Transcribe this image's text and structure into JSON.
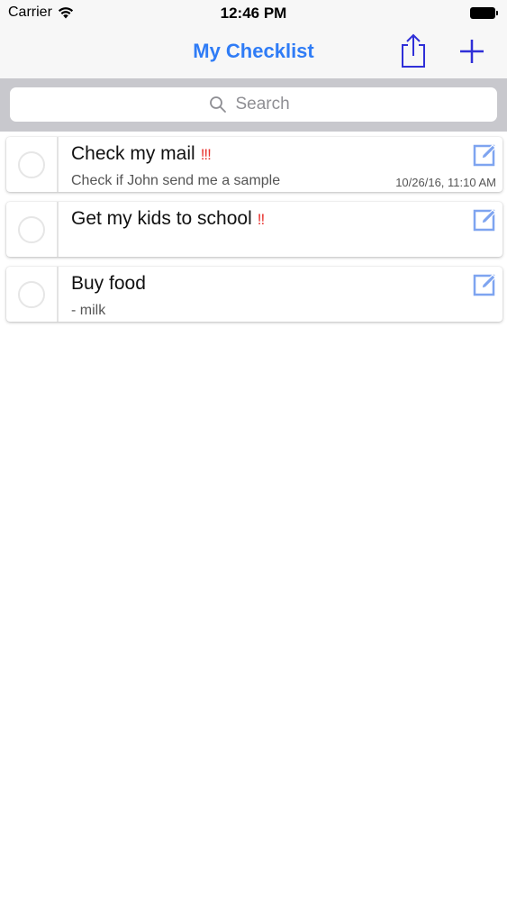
{
  "status_bar": {
    "carrier": "Carrier",
    "time": "12:46 PM"
  },
  "nav": {
    "title": "My Checklist",
    "share_icon": "share-icon",
    "add_icon": "plus-icon",
    "accent_color": "#2f7cf6"
  },
  "search": {
    "placeholder": "Search"
  },
  "items": [
    {
      "title": "Check my mail",
      "priority": "!!!",
      "note": "Check if John send me a sample",
      "date": "10/26/16, 11:10 AM",
      "checked": false
    },
    {
      "title": "Get my kids to school",
      "priority": "!!",
      "note": "",
      "date": "",
      "checked": false
    },
    {
      "title": "Buy food",
      "priority": "",
      "note": "- milk",
      "date": "",
      "checked": false
    }
  ],
  "colors": {
    "priority": "#e8332f",
    "edit_icon": "#7ea4f0",
    "search_bar_bg": "#c8c8cd"
  }
}
